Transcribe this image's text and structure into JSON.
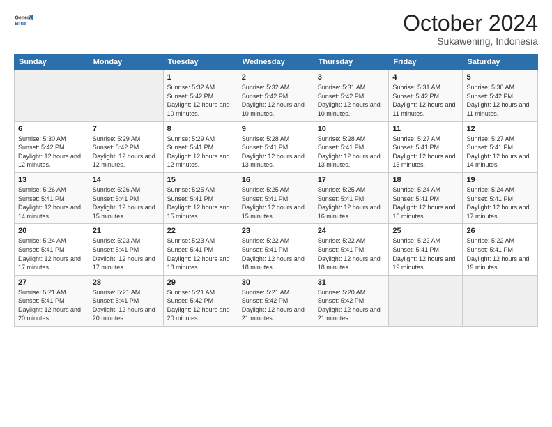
{
  "logo": {
    "line1": "General",
    "line2": "Blue"
  },
  "header": {
    "month": "October 2024",
    "location": "Sukawening, Indonesia"
  },
  "weekdays": [
    "Sunday",
    "Monday",
    "Tuesday",
    "Wednesday",
    "Thursday",
    "Friday",
    "Saturday"
  ],
  "weeks": [
    [
      {
        "day": "",
        "info": ""
      },
      {
        "day": "",
        "info": ""
      },
      {
        "day": "1",
        "info": "Sunrise: 5:32 AM\nSunset: 5:42 PM\nDaylight: 12 hours and 10 minutes."
      },
      {
        "day": "2",
        "info": "Sunrise: 5:32 AM\nSunset: 5:42 PM\nDaylight: 12 hours and 10 minutes."
      },
      {
        "day": "3",
        "info": "Sunrise: 5:31 AM\nSunset: 5:42 PM\nDaylight: 12 hours and 10 minutes."
      },
      {
        "day": "4",
        "info": "Sunrise: 5:31 AM\nSunset: 5:42 PM\nDaylight: 12 hours and 11 minutes."
      },
      {
        "day": "5",
        "info": "Sunrise: 5:30 AM\nSunset: 5:42 PM\nDaylight: 12 hours and 11 minutes."
      }
    ],
    [
      {
        "day": "6",
        "info": "Sunrise: 5:30 AM\nSunset: 5:42 PM\nDaylight: 12 hours and 12 minutes."
      },
      {
        "day": "7",
        "info": "Sunrise: 5:29 AM\nSunset: 5:42 PM\nDaylight: 12 hours and 12 minutes."
      },
      {
        "day": "8",
        "info": "Sunrise: 5:29 AM\nSunset: 5:41 PM\nDaylight: 12 hours and 12 minutes."
      },
      {
        "day": "9",
        "info": "Sunrise: 5:28 AM\nSunset: 5:41 PM\nDaylight: 12 hours and 13 minutes."
      },
      {
        "day": "10",
        "info": "Sunrise: 5:28 AM\nSunset: 5:41 PM\nDaylight: 12 hours and 13 minutes."
      },
      {
        "day": "11",
        "info": "Sunrise: 5:27 AM\nSunset: 5:41 PM\nDaylight: 12 hours and 13 minutes."
      },
      {
        "day": "12",
        "info": "Sunrise: 5:27 AM\nSunset: 5:41 PM\nDaylight: 12 hours and 14 minutes."
      }
    ],
    [
      {
        "day": "13",
        "info": "Sunrise: 5:26 AM\nSunset: 5:41 PM\nDaylight: 12 hours and 14 minutes."
      },
      {
        "day": "14",
        "info": "Sunrise: 5:26 AM\nSunset: 5:41 PM\nDaylight: 12 hours and 15 minutes."
      },
      {
        "day": "15",
        "info": "Sunrise: 5:25 AM\nSunset: 5:41 PM\nDaylight: 12 hours and 15 minutes."
      },
      {
        "day": "16",
        "info": "Sunrise: 5:25 AM\nSunset: 5:41 PM\nDaylight: 12 hours and 15 minutes."
      },
      {
        "day": "17",
        "info": "Sunrise: 5:25 AM\nSunset: 5:41 PM\nDaylight: 12 hours and 16 minutes."
      },
      {
        "day": "18",
        "info": "Sunrise: 5:24 AM\nSunset: 5:41 PM\nDaylight: 12 hours and 16 minutes."
      },
      {
        "day": "19",
        "info": "Sunrise: 5:24 AM\nSunset: 5:41 PM\nDaylight: 12 hours and 17 minutes."
      }
    ],
    [
      {
        "day": "20",
        "info": "Sunrise: 5:24 AM\nSunset: 5:41 PM\nDaylight: 12 hours and 17 minutes."
      },
      {
        "day": "21",
        "info": "Sunrise: 5:23 AM\nSunset: 5:41 PM\nDaylight: 12 hours and 17 minutes."
      },
      {
        "day": "22",
        "info": "Sunrise: 5:23 AM\nSunset: 5:41 PM\nDaylight: 12 hours and 18 minutes."
      },
      {
        "day": "23",
        "info": "Sunrise: 5:22 AM\nSunset: 5:41 PM\nDaylight: 12 hours and 18 minutes."
      },
      {
        "day": "24",
        "info": "Sunrise: 5:22 AM\nSunset: 5:41 PM\nDaylight: 12 hours and 18 minutes."
      },
      {
        "day": "25",
        "info": "Sunrise: 5:22 AM\nSunset: 5:41 PM\nDaylight: 12 hours and 19 minutes."
      },
      {
        "day": "26",
        "info": "Sunrise: 5:22 AM\nSunset: 5:41 PM\nDaylight: 12 hours and 19 minutes."
      }
    ],
    [
      {
        "day": "27",
        "info": "Sunrise: 5:21 AM\nSunset: 5:41 PM\nDaylight: 12 hours and 20 minutes."
      },
      {
        "day": "28",
        "info": "Sunrise: 5:21 AM\nSunset: 5:41 PM\nDaylight: 12 hours and 20 minutes."
      },
      {
        "day": "29",
        "info": "Sunrise: 5:21 AM\nSunset: 5:42 PM\nDaylight: 12 hours and 20 minutes."
      },
      {
        "day": "30",
        "info": "Sunrise: 5:21 AM\nSunset: 5:42 PM\nDaylight: 12 hours and 21 minutes."
      },
      {
        "day": "31",
        "info": "Sunrise: 5:20 AM\nSunset: 5:42 PM\nDaylight: 12 hours and 21 minutes."
      },
      {
        "day": "",
        "info": ""
      },
      {
        "day": "",
        "info": ""
      }
    ]
  ]
}
